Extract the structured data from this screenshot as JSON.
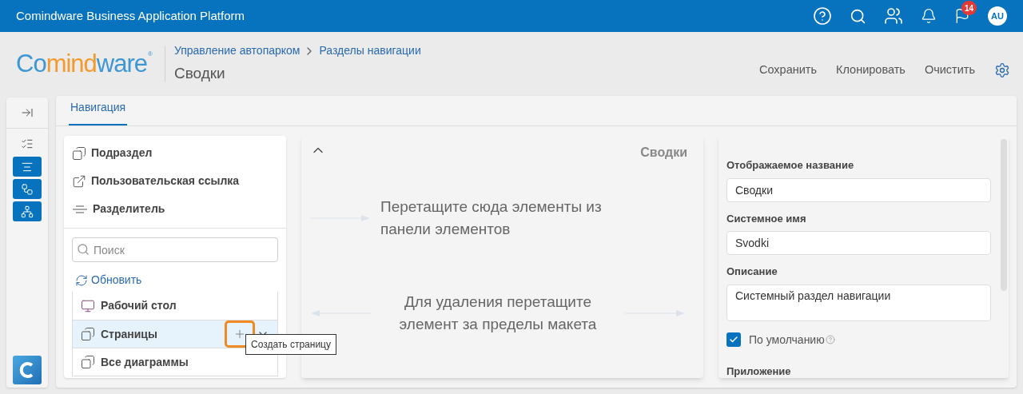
{
  "topbar": {
    "title": "Comindware Business Application Platform",
    "notifications_badge": "14",
    "avatar": "AU"
  },
  "header": {
    "logo": {
      "part1": "Co",
      "part2": "mind",
      "part3": "ware",
      "mark": "®"
    },
    "breadcrumbs": [
      "Управление автопарком",
      "Разделы навигации"
    ],
    "page_title": "Сводки",
    "actions": [
      "Сохранить",
      "Клонировать",
      "Очистить"
    ]
  },
  "rail": [
    {
      "kind": "collapse",
      "selected": false
    },
    {
      "kind": "checklist",
      "selected": false
    },
    {
      "kind": "menu",
      "selected": true
    },
    {
      "kind": "diagram",
      "selected": true
    },
    {
      "kind": "hierarchy",
      "selected": true
    }
  ],
  "tabs": [
    {
      "label": "Навигация",
      "selected": true
    }
  ],
  "palette": {
    "items": [
      {
        "kind": "section",
        "label": "Подраздел"
      },
      {
        "kind": "link",
        "label": "Пользовательская ссылка"
      },
      {
        "kind": "divider",
        "label": "Разделитель"
      }
    ],
    "search": {
      "placeholder": "Поиск"
    },
    "refresh": "Обновить",
    "list": [
      {
        "kind": "desktop",
        "label": "Рабочий стол",
        "selected": false
      },
      {
        "kind": "pages",
        "label": "Страницы",
        "selected": true
      },
      {
        "kind": "pages",
        "label": "Все диаграммы",
        "selected": false
      }
    ],
    "tooltip": "Создать страницу"
  },
  "canvas": {
    "title": "Сводки",
    "drop_hint": "Перетащите сюда элементы из панели элементов",
    "delete_hint": "Для удаления перетащите элемент за пределы макета"
  },
  "properties": {
    "fields": [
      {
        "label": "Отображаемое название",
        "value": "Сводки",
        "kind": "input"
      },
      {
        "label": "Системное имя",
        "value": "Svodki",
        "kind": "input"
      },
      {
        "label": "Описание",
        "value": "Системный раздел навигации",
        "kind": "textarea"
      }
    ],
    "default": {
      "label": "По умолчанию",
      "checked": true
    },
    "next_label": "Приложение"
  }
}
